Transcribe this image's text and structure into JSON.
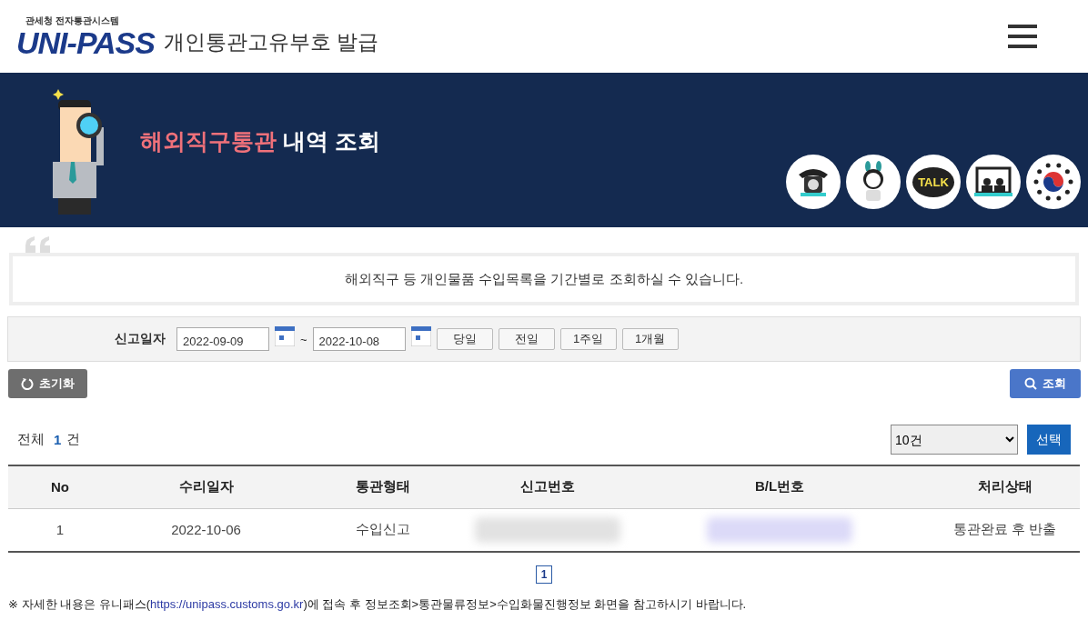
{
  "header": {
    "logo_caption": "관세청 전자통관시스템",
    "logo_text": "UNI-PASS",
    "title": "개인통관고유부호 발급"
  },
  "banner": {
    "title_highlight": "해외직구통관",
    "title_rest": "내역 조회",
    "quick_icons": [
      {
        "kind": "phone"
      },
      {
        "kind": "mascot"
      },
      {
        "kind": "talk",
        "label": "TALK"
      },
      {
        "kind": "video"
      },
      {
        "kind": "emblem"
      }
    ]
  },
  "notice": "해외직구 등 개인물품 수입목록을 기간별로 조회하실 수 있습니다.",
  "search": {
    "label": "신고일자",
    "date_from": "2022-09-09",
    "separator": "~",
    "date_to": "2022-10-08",
    "period_buttons": [
      "당일",
      "전일",
      "1주일",
      "1개월"
    ],
    "reset_button": "초기화",
    "search_button": "조회"
  },
  "summary": {
    "total_label": "전체",
    "total_count": "1",
    "unit": "건",
    "page_size": "10건",
    "apply_button": "선택"
  },
  "table": {
    "columns": [
      "No",
      "수리일자",
      "통관형태",
      "신고번호",
      "B/L번호",
      "처리상태"
    ],
    "rows": [
      {
        "cells": [
          "1",
          "2022-10-06",
          "수입신고",
          null,
          null,
          "통관완료 후 반출"
        ]
      }
    ]
  },
  "pagination": [
    {
      "label": "1",
      "selected": true
    }
  ],
  "footnote": {
    "before": "※ 자세한 내용은 유니패스(",
    "link": "https://unipass.customs.go.kr",
    "after": ")에 접속 후 정보조회>통관물류정보>수입화물진행정보 화면을 참고하시기 바랍니다."
  }
}
